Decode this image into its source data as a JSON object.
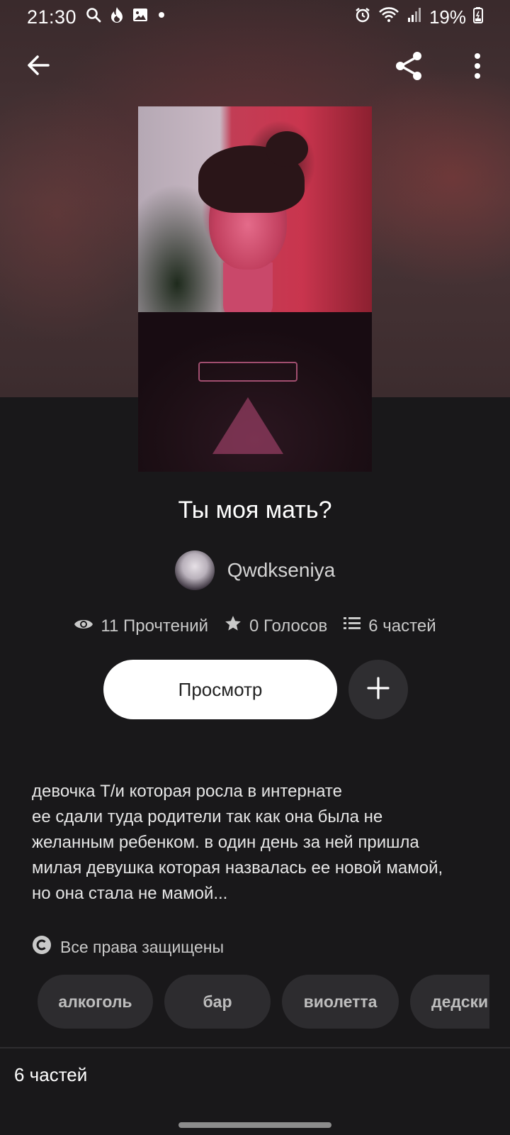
{
  "status_bar": {
    "time": "21:30",
    "battery": "19%",
    "left_icons": [
      "search-icon",
      "fire-icon",
      "image-icon",
      "dot-icon"
    ],
    "right_icons": [
      "alarm-icon",
      "wifi-icon",
      "signal-icon",
      "battery-icon"
    ]
  },
  "top_bar": {
    "back_icon": "arrow-left-icon",
    "share_icon": "share-icon",
    "more_icon": "more-vertical-icon"
  },
  "story": {
    "title": "Ты моя мать?",
    "author": "Qwdkseniya",
    "stats": {
      "reads": "11 Прочтений",
      "votes": "0 Голосов",
      "parts": "6 частей"
    },
    "read_button": "Просмотр",
    "description_lines": [
      "девочка Т/и которая росла в интернате",
      "ее сдали туда родители так как она была не",
      "желанным ребенком. в один день за ней пришла",
      "милая девушка которая назвалась ее новой мамой,",
      "но она стала не мамой..."
    ],
    "copyright": "Все права защищены",
    "tags": [
      "алкоголь",
      "бар",
      "виолетта",
      "дедски"
    ],
    "parts_label": "6 частей"
  },
  "colors": {
    "background": "#19181a",
    "button_primary": "#ffffff",
    "chip_background": "#2d2c2f"
  }
}
